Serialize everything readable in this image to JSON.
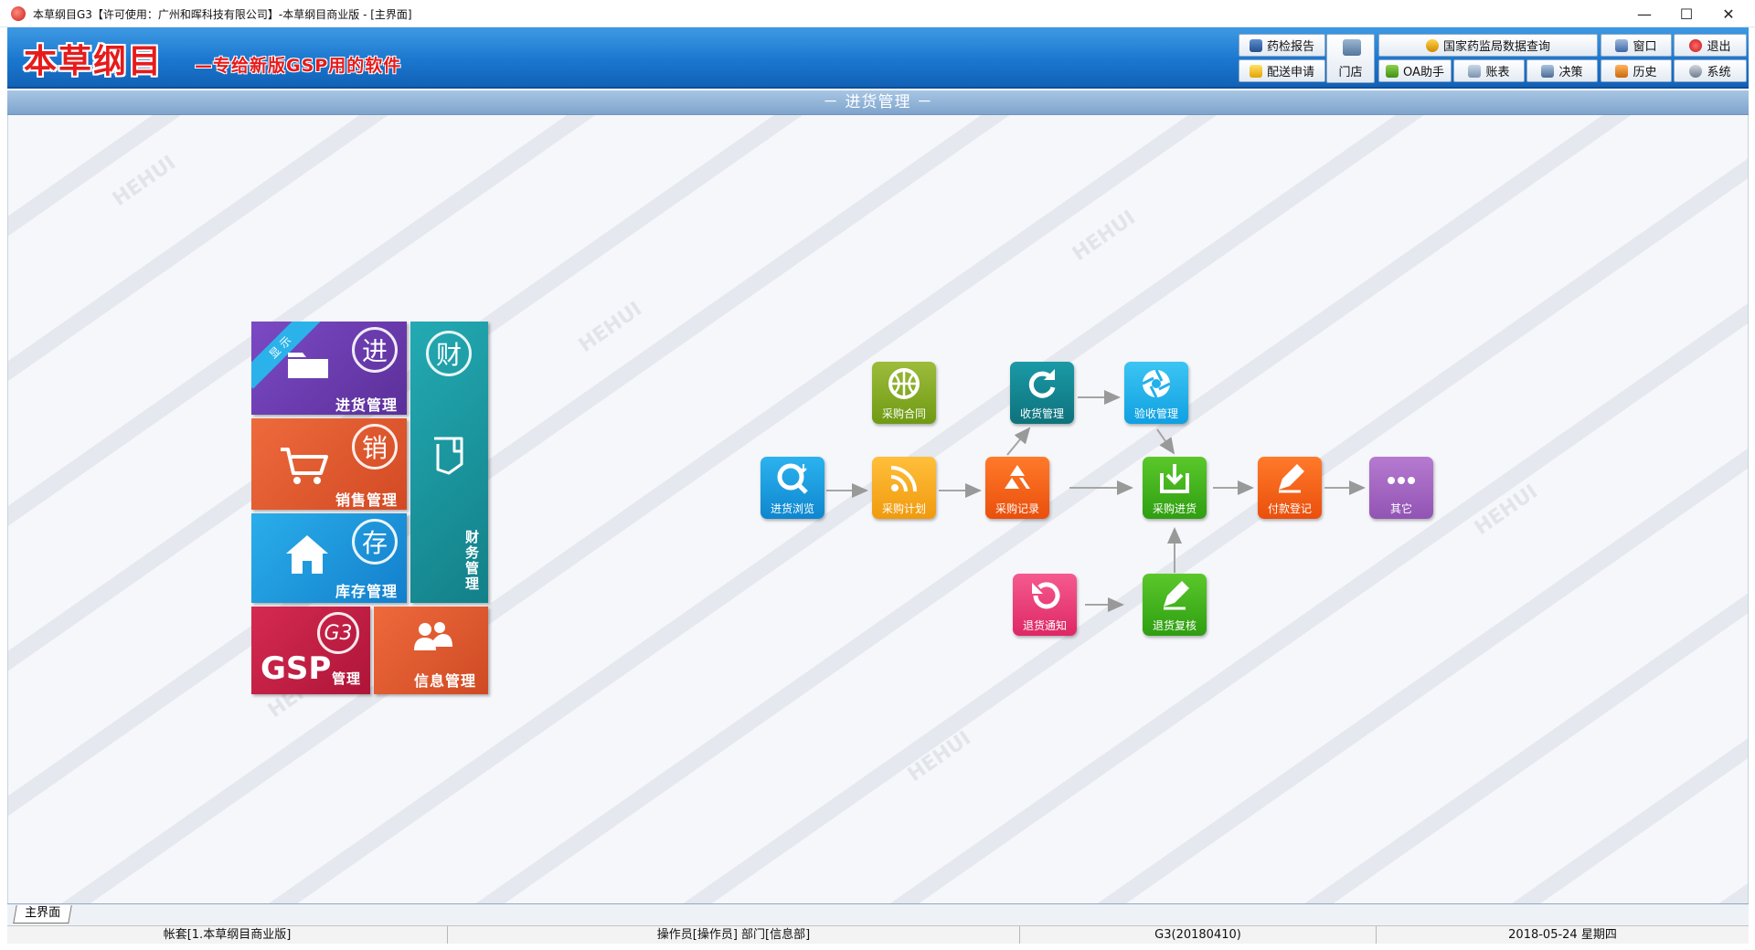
{
  "window": {
    "title": "本草纲目G3【许可使用：广州和晖科技有限公司】-本草纲目商业版 - [主界面]",
    "minimize": "—",
    "maximize": "☐",
    "close": "✕"
  },
  "header": {
    "logo_text": "本草纲目",
    "slogan": "—专给新版GSP用的软件"
  },
  "toolbar": {
    "drug_report": "药检报告",
    "delivery_request": "配送申请",
    "store": "门店",
    "nmpa_query": "国家药监局数据查询",
    "oa_assistant": "OA助手",
    "ledger": "账表",
    "decision": "决策",
    "window_menu": "窗口",
    "history": "历史",
    "exit": "退出",
    "system": "系统"
  },
  "section_title": "－ 进货管理 －",
  "watermark": "HEHUI",
  "tiles": {
    "purchase": {
      "label": "进货管理",
      "char": "进",
      "ribbon": "显示"
    },
    "sales": {
      "label": "销售管理",
      "char": "销"
    },
    "inventory": {
      "label": "库存管理",
      "char": "存"
    },
    "finance": {
      "label": "财务管理",
      "char": "财"
    },
    "gsp": {
      "label": "管理",
      "logo": "GSP",
      "char": "G3"
    },
    "info": {
      "label": "信息管理"
    }
  },
  "flow": {
    "browse": "进货浏览",
    "plan": "采购计划",
    "contract": "采购合同",
    "record": "采购记录",
    "receive": "收货管理",
    "inspect": "验收管理",
    "stock_in": "采购进货",
    "payment": "付款登记",
    "other": "其它",
    "return_notice": "退货通知",
    "return_review": "退货复核"
  },
  "tabs": {
    "main": "主界面"
  },
  "status": {
    "account": "帐套[1.本草纲目商业版]",
    "operator": "操作员[操作员] 部门[信息部]",
    "version": "G3(20180410)",
    "date": "2018-05-24 星期四"
  },
  "colors": {
    "header_blue": "#1a77cf",
    "tile_purchase": "#6a3fb0",
    "tile_sales": "#e2562f",
    "tile_inventory": "#1a9fe0",
    "tile_finance": "#1a9aa3",
    "tile_gsp": "#c41d45",
    "tile_info": "#dd5530"
  }
}
